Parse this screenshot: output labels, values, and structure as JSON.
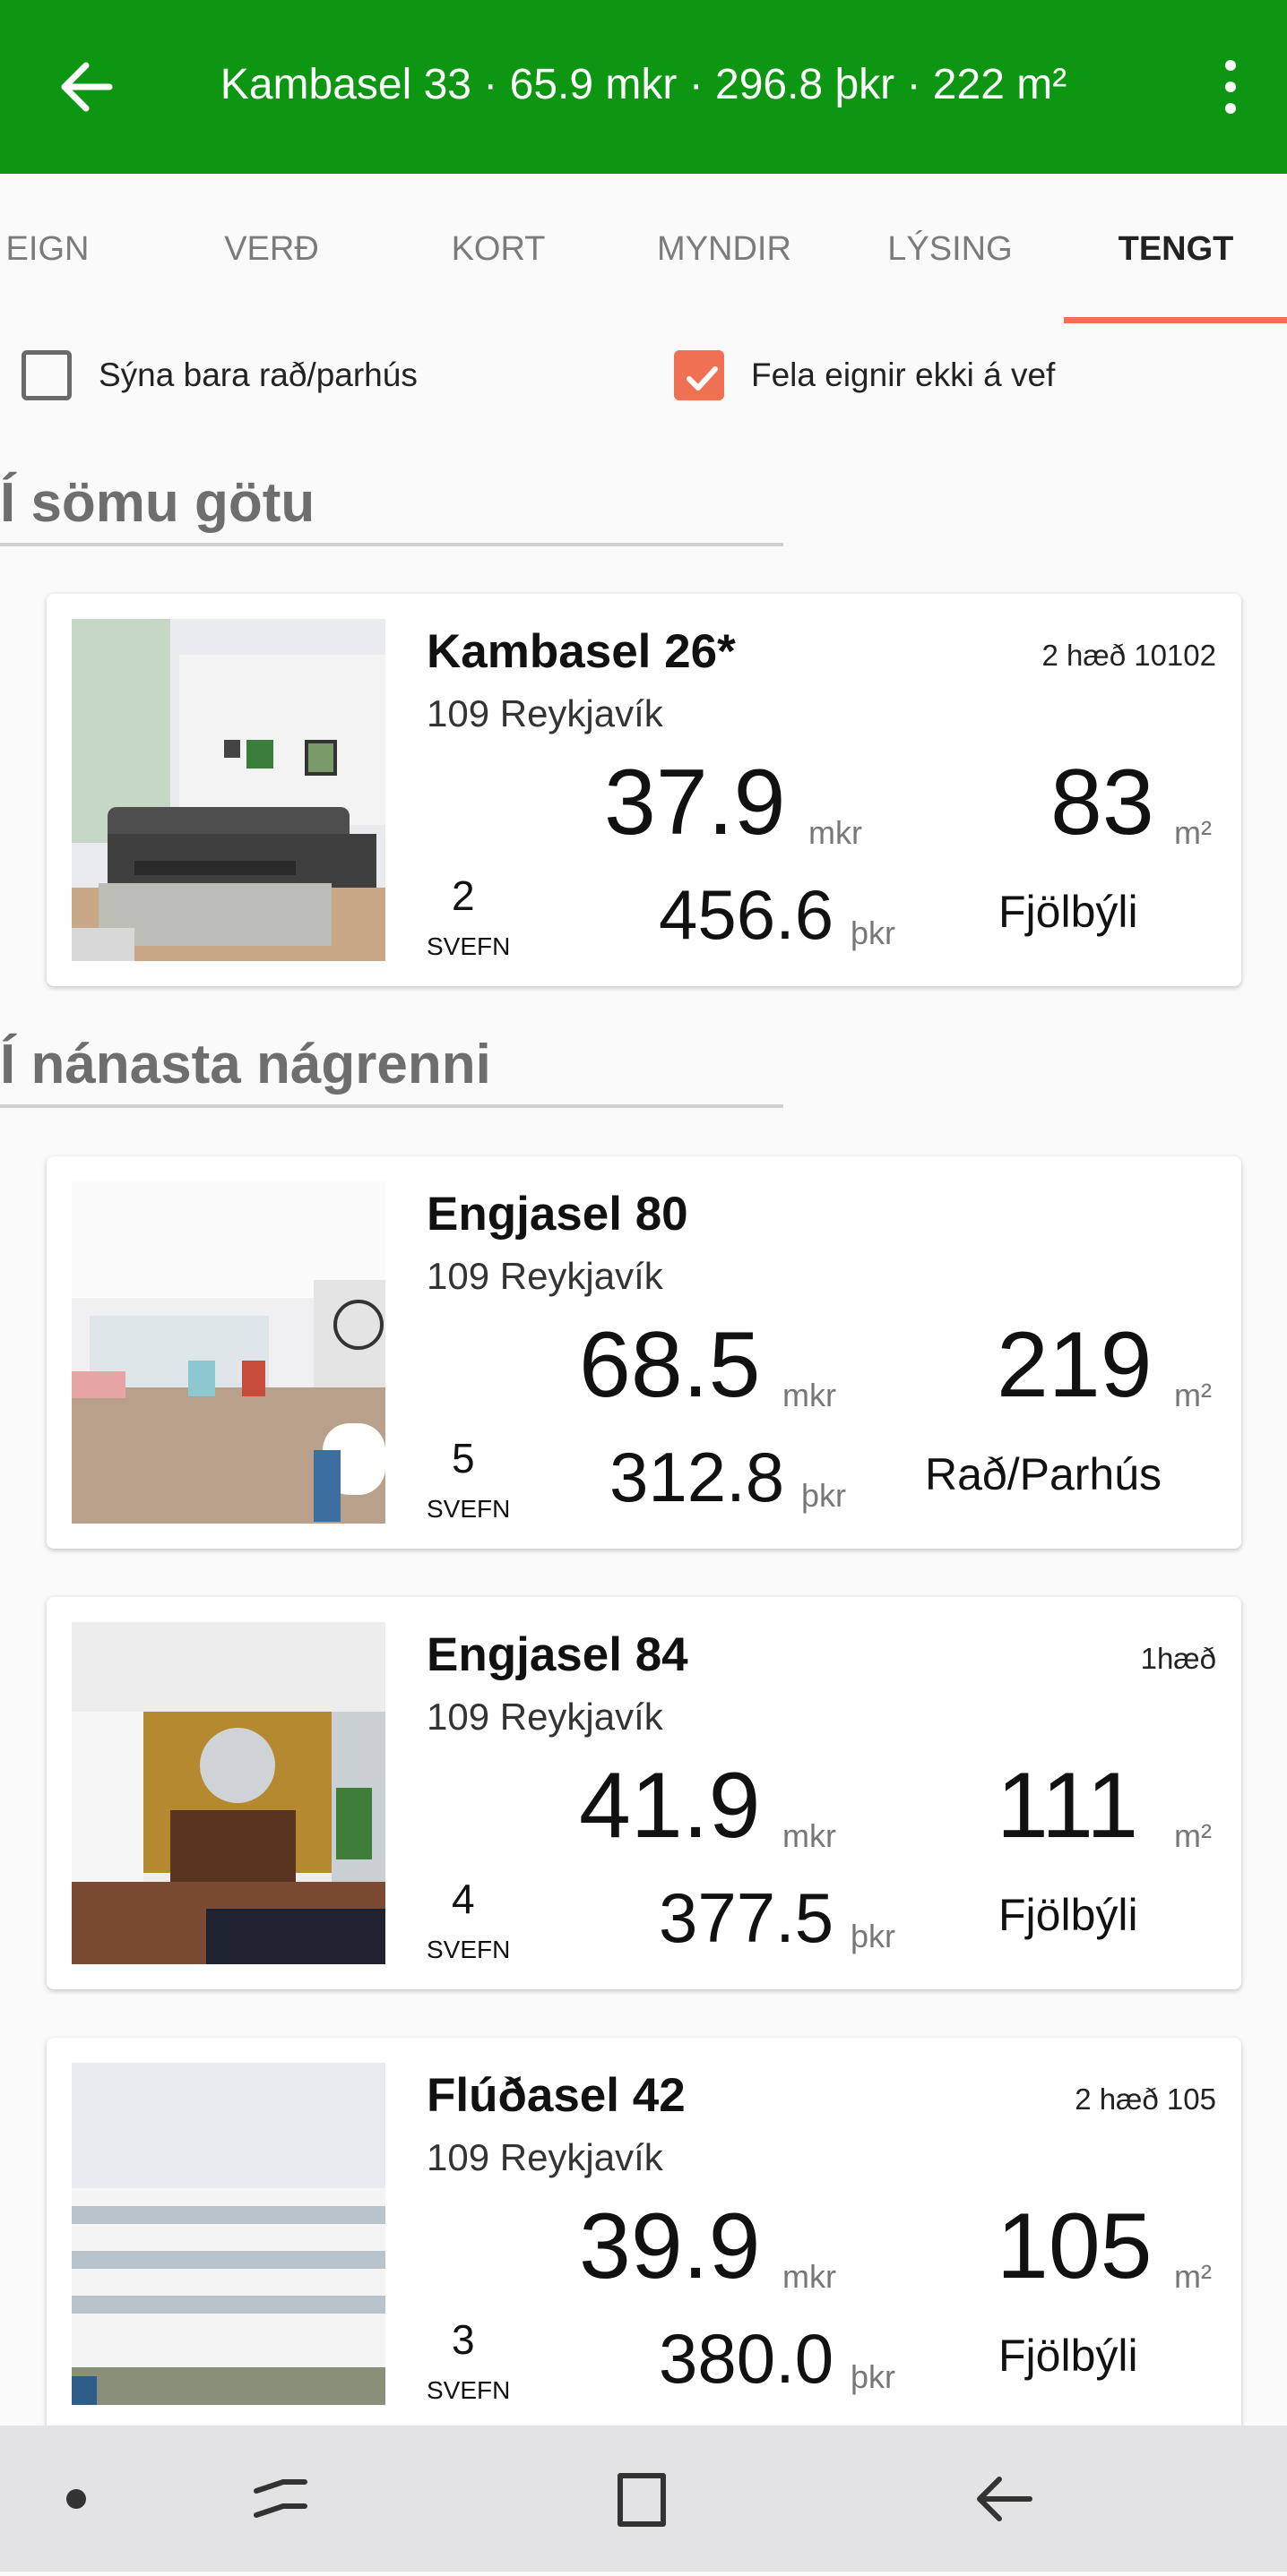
{
  "appbar": {
    "title": "Kambasel 33 · 65.9 mkr · 296.8 þkr · 222 m²",
    "color": "#0c9612"
  },
  "tabs": [
    {
      "label": "EIGN",
      "active": false
    },
    {
      "label": "VERÐ",
      "active": false
    },
    {
      "label": "KORT",
      "active": false
    },
    {
      "label": "MYNDIR",
      "active": false
    },
    {
      "label": "LÝSING",
      "active": false
    },
    {
      "label": "TENGT",
      "active": true
    }
  ],
  "filters": {
    "row_houses_only": {
      "label": "Sýna bara rað/parhús",
      "checked": false
    },
    "hide_offline": {
      "label": "Fela eignir ekki á vef",
      "checked": true
    }
  },
  "sections": {
    "same_street": "Í sömu götu",
    "nearby": "Í nánasta nágrenni"
  },
  "units": {
    "price": "mkr",
    "ppm": "þkr",
    "area": "m²",
    "rooms": "SVEFN"
  },
  "listings": [
    {
      "name": "Kambasel 26*",
      "city": "109 Reykjavík",
      "extra": "2 hæð  10102",
      "price": "37.9",
      "area": "83",
      "rooms": "2",
      "ppm": "456.6",
      "type": "Fjölbýli"
    },
    {
      "name": "Engjasel 80",
      "city": "109 Reykjavík",
      "extra": "",
      "price": "68.5",
      "area": "219",
      "rooms": "5",
      "ppm": "312.8",
      "type": "Rað/Parhús"
    },
    {
      "name": "Engjasel 84",
      "city": "109 Reykjavík",
      "extra": "1hæð",
      "price": "41.9",
      "area": "111",
      "rooms": "4",
      "ppm": "377.5",
      "type": "Fjölbýli"
    },
    {
      "name": "Flúðasel 42",
      "city": "109 Reykjavík",
      "extra": "2 hæð  105",
      "price": "39.9",
      "area": "105",
      "rooms": "3",
      "ppm": "380.0",
      "type": "Fjölbýli"
    }
  ],
  "colors": {
    "accent": "#f07053",
    "header": "#0c9612"
  }
}
